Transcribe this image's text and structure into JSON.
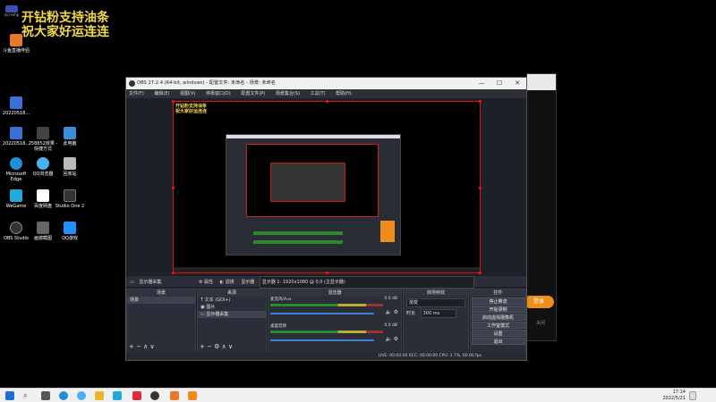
{
  "overlay": {
    "line1": "开钻粉支持油条",
    "line2": "祝大家好运连连",
    "tag_label": "occ•khp"
  },
  "desktop_icons": [
    {
      "label": "斗鱼直播伴侣",
      "color": "#e8792a"
    },
    {
      "label": "20220518...",
      "color": "#3b6fd8"
    },
    {
      "label": "20220518...",
      "color": "#3b6fd8"
    },
    {
      "label": "258852效果 - 快捷方式",
      "color": "#444"
    },
    {
      "label": "此电脑",
      "color": "#3a8fd8"
    },
    {
      "label": "Microsoft Edge",
      "color": "#1f8fd8"
    },
    {
      "label": "QQ浏览器",
      "color": "#4ab0f0"
    },
    {
      "label": "回收站",
      "color": "#bbb"
    },
    {
      "label": "WeGame",
      "color": "#2ad"
    },
    {
      "label": "百度网盘",
      "color": "#fff"
    },
    {
      "label": "Studio One 2",
      "color": "#333"
    },
    {
      "label": "OBS Studio",
      "color": "#333"
    },
    {
      "label": "画镜截图",
      "color": "#666"
    },
    {
      "label": "QQ游戏",
      "color": "#1e90ff"
    }
  ],
  "obs": {
    "title": "OBS 27.2.4 (64-bit, windows) - 配置文件: 未命名 - 场景: 未命名",
    "menu": [
      "文件(F)",
      "编辑(E)",
      "视图(V)",
      "停靠窗口(D)",
      "配置文件(P)",
      "场景集合(S)",
      "工具(T)",
      "帮助(H)"
    ],
    "window_buttons": [
      "—",
      "☐",
      "✕"
    ],
    "source_bar": {
      "label": "显示器采集",
      "props": "属性",
      "filters": "滤镜",
      "display": "显示器",
      "display_value": "显示器 1: 1920x1080 @ 0,0 (主显示器)"
    },
    "docks": {
      "scenes": {
        "title": "场景",
        "items": [
          "场景"
        ]
      },
      "sources": {
        "title": "来源",
        "items": [
          "文本 (GDI+)",
          "图片",
          "显示器采集"
        ]
      },
      "mixer": {
        "title": "混音器",
        "tracks": [
          {
            "name": "麦克风/Aux",
            "db": "0.0 dB"
          },
          {
            "name": "桌面音频",
            "db": "0.0 dB"
          }
        ]
      },
      "transitions": {
        "title": "转场特效",
        "type": "渐变",
        "duration_label": "时长",
        "duration": "300 ms"
      },
      "controls": {
        "title": "控件",
        "buttons": [
          "停止推流",
          "开始录制",
          "启动虚拟摄像机",
          "工作室模式",
          "设置",
          "退出"
        ]
      }
    },
    "status": "LIVE: 00:00:00   REC: 00:00:00   CPU: 3.7%, 60.00 fps"
  },
  "bg_window": {
    "button": "登录",
    "small_text": "关闭"
  },
  "taskbar": {
    "time": "17:14",
    "date": "2022/5/21"
  },
  "colors": {
    "accent_red": "#dd1111",
    "obs_bg": "#272a33",
    "overlay_yellow": "#f2d84a"
  }
}
